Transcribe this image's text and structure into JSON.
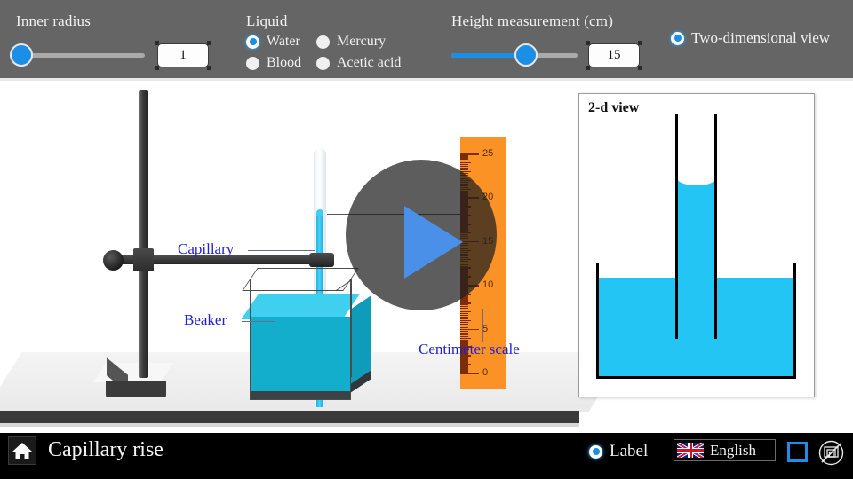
{
  "controls": {
    "inner_radius": {
      "label": "Inner radius",
      "value": "1",
      "slider_percent": 3,
      "icon": "slider-thumb"
    },
    "liquid": {
      "label": "Liquid",
      "options": [
        {
          "label": "Water",
          "selected": true
        },
        {
          "label": "Mercury",
          "selected": false
        },
        {
          "label": "Blood",
          "selected": false
        },
        {
          "label": "Acetic acid",
          "selected": false
        }
      ]
    },
    "height_measurement": {
      "label": "Height measurement (cm)",
      "value": "15",
      "slider_percent": 58
    },
    "two_dimensional_view": {
      "label": "Two-dimensional view",
      "selected": true
    }
  },
  "scene": {
    "labels": {
      "capillary": "Capillary",
      "beaker": "Beaker",
      "centimeter_scale": "Centimeter scale"
    },
    "ruler": {
      "numbers": [
        "25",
        "20",
        "15",
        "10",
        "5",
        "0"
      ],
      "unit": "cm",
      "color": "#fb9226",
      "tick_color": "#7d2d06"
    },
    "play_button": {
      "icon": "play-icon",
      "color": "#4a90e8"
    },
    "liquid_color": "#22c5f4"
  },
  "panel_2d": {
    "title": "2-d view"
  },
  "footer": {
    "home_icon": "home-icon",
    "title": "Capillary rise",
    "label_toggle": {
      "label": "Label",
      "selected": true
    },
    "language": {
      "flag": "uk-flag-icon",
      "name": "English"
    },
    "fullscreen_icon": "fullscreen-icon",
    "hide_layers_icon": "no-layers-icon"
  },
  "theme": {
    "topbar_bg": "#656565",
    "accent": "#1b8ee5",
    "footer_bg": "#000000",
    "label_text": "#2020d8"
  }
}
